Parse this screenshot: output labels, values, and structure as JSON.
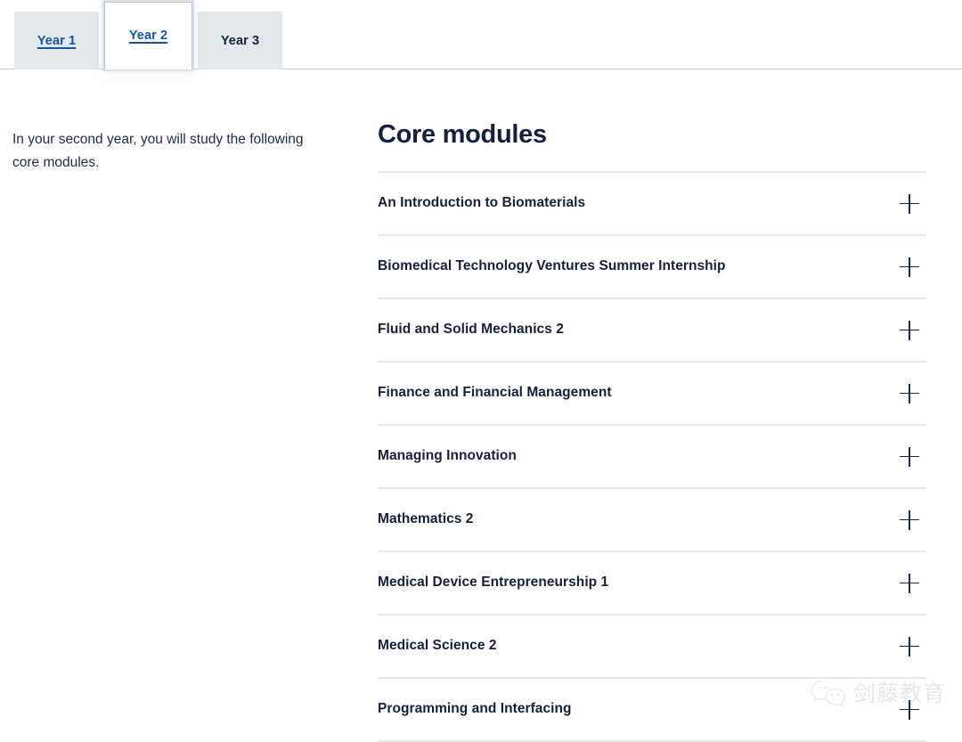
{
  "tabs": {
    "items": [
      {
        "label": "Year 1",
        "state": "link"
      },
      {
        "label": "Year 2",
        "state": "active"
      },
      {
        "label": "Year 3",
        "state": "plain"
      }
    ],
    "active_index": 1
  },
  "left_column": {
    "intro": "In your second year, you will study the following core modules."
  },
  "modules_section": {
    "heading": "Core modules",
    "toggle_icon": "plus-icon",
    "items": [
      {
        "title": "An Introduction to Biomaterials"
      },
      {
        "title": "Biomedical Technology Ventures Summer Internship"
      },
      {
        "title": "Fluid and Solid Mechanics 2"
      },
      {
        "title": "Finance and Financial Management"
      },
      {
        "title": "Managing Innovation"
      },
      {
        "title": "Mathematics 2"
      },
      {
        "title": "Medical Device Entrepreneurship 1"
      },
      {
        "title": "Medical Science 2"
      },
      {
        "title": "Programming and Interfacing"
      }
    ]
  },
  "watermark": {
    "icon": "wechat-icon",
    "text": "剑藤教育"
  },
  "colors": {
    "navy": "#14203c",
    "link_blue": "#1159a6",
    "tab_inactive_bg": "#e3e8eb",
    "divider": "#e6e8ea",
    "page_border": "#c9ced6",
    "watermark_gray": "#cfd2d6"
  }
}
